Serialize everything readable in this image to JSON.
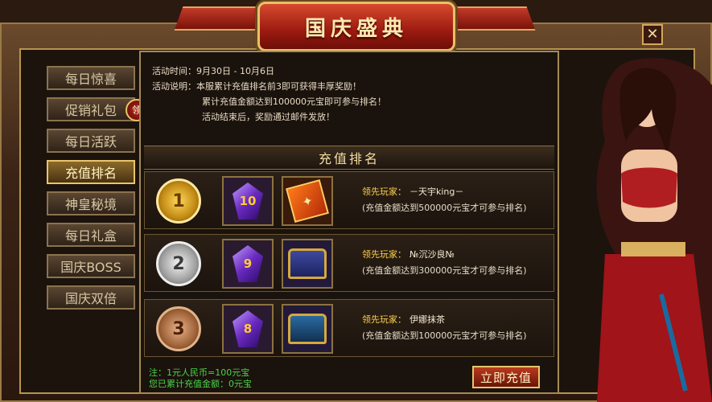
{
  "title": "国庆盛典",
  "close": "✕",
  "sidebar": {
    "items": [
      {
        "label": "每日惊喜"
      },
      {
        "label": "促销礼包",
        "badge": "领"
      },
      {
        "label": "每日活跃"
      },
      {
        "label": "充值排名"
      },
      {
        "label": "神皇秘境"
      },
      {
        "label": "每日礼盒"
      },
      {
        "label": "国庆BOSS"
      },
      {
        "label": "国庆双倍"
      }
    ],
    "active": "充值排名"
  },
  "info": {
    "time": "活动时间：9月30日 - 10月6日",
    "desc1": "活动说明：本服累计充值排名前3即可获得丰厚奖励！",
    "desc2": "累计充值金额达到100000元宝即可参与排名！",
    "desc3": "活动结束后，奖励通过邮件发放！"
  },
  "section_title": "充值排名",
  "ranks": [
    {
      "rank": "1",
      "gem": "10",
      "lead_label": "领先玩家：",
      "player": "－天宇king－",
      "condition": "(充值金额达到500000元宝才可参与排名)"
    },
    {
      "rank": "2",
      "gem": "9",
      "lead_label": "领先玩家：",
      "player": "№沉沙良№",
      "condition": "(充值金额达到300000元宝才可参与排名)"
    },
    {
      "rank": "3",
      "gem": "8",
      "lead_label": "领先玩家：",
      "player": "伊娜抹茶",
      "condition": "(充值金额达到100000元宝才可参与排名)"
    }
  ],
  "footer": {
    "note": "注：1元人民币=100元宝",
    "total": "您已累计充值金额：0元宝"
  },
  "recharge_button": "立即充值"
}
